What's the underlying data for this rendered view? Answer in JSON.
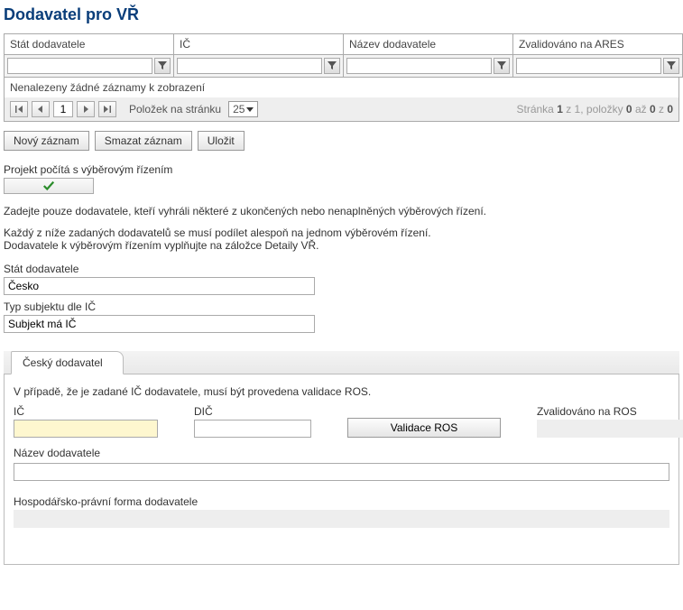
{
  "title": "Dodavatel pro VŘ",
  "grid": {
    "columns": [
      "Stát dodavatele",
      "IČ",
      "Název dodavatele",
      "Zvalidováno na ARES"
    ],
    "empty_text": "Nenalezeny žádné záznamy k zobrazení"
  },
  "pager": {
    "page": "1",
    "items_per_page_label": "Položek na stránku",
    "page_size": "25",
    "summary_prefix": "Stránka ",
    "summary_page_of": "1",
    "summary_mid": " z 1, položky ",
    "summary_from": "0",
    "summary_mid2": " až ",
    "summary_to": "0",
    "summary_mid3": " z ",
    "summary_total": "0"
  },
  "buttons": {
    "new": "Nový záznam",
    "delete": "Smazat záznam",
    "save": "Uložit"
  },
  "vr_checkbox_label": "Projekt počítá s výběrovým řízením",
  "info1": "Zadejte pouze dodavatele, kteří vyhráli některé z ukončených nebo nenaplněných výběrových řízení.",
  "info2": "Každý z níže zadaných dodavatelů se musí podílet alespoň na jednom výběrovém řízení.",
  "info3": "Dodavatele k výběrovým řízením vyplňujte na záložce Detaily VŘ.",
  "fields": {
    "stat_label": "Stát dodavatele",
    "stat_value": "Česko",
    "typ_label": "Typ subjektu dle IČ",
    "typ_value": "Subjekt má IČ"
  },
  "tab": {
    "label": "Český dodavatel",
    "note": "V případě, že je zadané IČ dodavatele, musí být provedena validace ROS.",
    "ic_label": "IČ",
    "dic_label": "DIČ",
    "validate_btn": "Validace ROS",
    "ros_label": "Zvalidováno na ROS",
    "nazev_label": "Název dodavatele",
    "forma_label": "Hospodářsko-právní forma dodavatele",
    "ic_value": "",
    "dic_value": "",
    "ros_value": "",
    "nazev_value": "",
    "forma_value": ""
  }
}
